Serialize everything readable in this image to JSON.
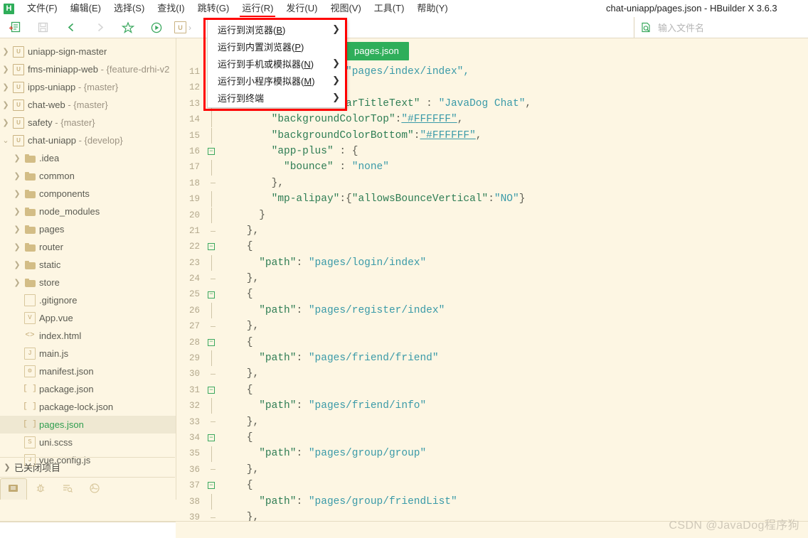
{
  "window": {
    "title": "chat-uniapp/pages.json - HBuilder X 3.6.3",
    "logo_text": "H"
  },
  "menubar": {
    "items": [
      {
        "label": "文件(F)",
        "highlighted": false
      },
      {
        "label": "编辑(E)",
        "highlighted": false
      },
      {
        "label": "选择(S)",
        "highlighted": false
      },
      {
        "label": "查找(I)",
        "highlighted": false
      },
      {
        "label": "跳转(G)",
        "highlighted": false
      },
      {
        "label": "运行(R)",
        "highlighted": true
      },
      {
        "label": "发行(U)",
        "highlighted": false
      },
      {
        "label": "视图(V)",
        "highlighted": false
      },
      {
        "label": "工具(T)",
        "highlighted": false
      },
      {
        "label": "帮助(Y)",
        "highlighted": false
      }
    ]
  },
  "toolbar": {
    "icons": [
      "new-file-icon",
      "save-icon",
      "back-arrow-icon",
      "forward-arrow-icon",
      "star-icon",
      "run-play-icon",
      "uniapp-chip-icon"
    ],
    "uni_chip_label": "U",
    "caret": "›"
  },
  "search": {
    "icon": "file-search-icon",
    "placeholder": "输入文件名",
    "value": ""
  },
  "dropdown": {
    "name": "run-menu",
    "items": [
      {
        "label": "运行到浏览器(B)",
        "mnemonic": "B",
        "submenu": true
      },
      {
        "label": "运行到内置浏览器(P)",
        "mnemonic": "P",
        "submenu": false
      },
      {
        "label": "运行到手机或模拟器(N)",
        "mnemonic": "N",
        "submenu": true
      },
      {
        "label": "运行到小程序模拟器(M)",
        "mnemonic": "M",
        "submenu": true
      },
      {
        "label": "运行到终端",
        "mnemonic": "",
        "submenu": true
      }
    ],
    "arrow_glyph": "❯",
    "highlight_color": "#ff0000"
  },
  "sidebar": {
    "projects": [
      {
        "name": "uniapp-sign-master",
        "branch": "",
        "expanded": false,
        "icon": "uniapp-project-icon"
      },
      {
        "name": "fms-miniapp-web",
        "branch": " - {feature-drhi-v2",
        "expanded": false,
        "icon": "uniapp-project-icon"
      },
      {
        "name": "ipps-uniapp",
        "branch": " - {master}",
        "expanded": false,
        "icon": "uniapp-project-icon"
      },
      {
        "name": "chat-web",
        "branch": " - {master}",
        "expanded": false,
        "icon": "uniapp-project-icon"
      },
      {
        "name": "safety",
        "branch": " - {master}",
        "expanded": false,
        "icon": "uniapp-project-icon"
      },
      {
        "name": "chat-uniapp",
        "branch": " - {develop}",
        "expanded": true,
        "icon": "uniapp-project-icon"
      }
    ],
    "children": [
      {
        "name": ".idea",
        "type": "folder",
        "icon": "folder-icon",
        "selected": false
      },
      {
        "name": "common",
        "type": "folder",
        "icon": "folder-icon",
        "selected": false
      },
      {
        "name": "components",
        "type": "folder",
        "icon": "folder-icon",
        "selected": false
      },
      {
        "name": "node_modules",
        "type": "folder",
        "icon": "folder-icon",
        "selected": false
      },
      {
        "name": "pages",
        "type": "folder",
        "icon": "folder-icon",
        "selected": false
      },
      {
        "name": "router",
        "type": "folder",
        "icon": "folder-icon",
        "selected": false
      },
      {
        "name": "static",
        "type": "folder",
        "icon": "folder-icon",
        "selected": false
      },
      {
        "name": "store",
        "type": "folder",
        "icon": "folder-icon",
        "selected": false
      },
      {
        "name": ".gitignore",
        "type": "file",
        "icon": "blank-file-icon",
        "glyph": "",
        "selected": false
      },
      {
        "name": "App.vue",
        "type": "file",
        "icon": "vue-file-icon",
        "glyph": "V",
        "selected": false
      },
      {
        "name": "index.html",
        "type": "file",
        "icon": "html-file-icon",
        "glyph": "<>",
        "selected": false
      },
      {
        "name": "main.js",
        "type": "file",
        "icon": "js-file-icon",
        "glyph": "J",
        "selected": false
      },
      {
        "name": "manifest.json",
        "type": "file",
        "icon": "manifest-file-icon",
        "glyph": "⚙",
        "selected": false
      },
      {
        "name": "package.json",
        "type": "file",
        "icon": "json-file-icon",
        "glyph": "[ ]",
        "selected": false
      },
      {
        "name": "package-lock.json",
        "type": "file",
        "icon": "json-file-icon",
        "glyph": "[ ]",
        "selected": false
      },
      {
        "name": "pages.json",
        "type": "file",
        "icon": "json-file-icon",
        "glyph": "[ ]",
        "selected": true
      },
      {
        "name": "uni.scss",
        "type": "file",
        "icon": "scss-file-icon",
        "glyph": "S",
        "selected": false
      },
      {
        "name": "vue.config.js",
        "type": "file",
        "icon": "js-file-icon",
        "glyph": "J",
        "selected": false
      }
    ],
    "closed_projects_label": "已关闭项目",
    "bottom_tabs": [
      {
        "name": "project-explorer-tab",
        "icon": "files-icon",
        "active": true
      },
      {
        "name": "debug-tab",
        "icon": "bug-icon",
        "active": false
      },
      {
        "name": "outline-tab",
        "icon": "outline-icon",
        "active": false
      },
      {
        "name": "cloud-tab",
        "icon": "cloud-icon",
        "active": false
      }
    ]
  },
  "editor": {
    "tab_label": "pages.json",
    "tab_color": "#2fae5a",
    "lines": [
      {
        "n": 11,
        "fold": "bar",
        "tokens": [
          {
            "t": "                    ",
            "c": "p"
          },
          {
            "t": "\"pages/index/index\",",
            "c": "s"
          }
        ]
      },
      {
        "n": 12,
        "fold": "bar",
        "tokens": [
          {
            "t": "",
            "c": "p"
          }
        ]
      },
      {
        "n": 13,
        "fold": "bar",
        "tokens": [
          {
            "t": "        ",
            "c": "p"
          },
          {
            "t": "\"navigationBarTitleText\"",
            "c": "k"
          },
          {
            "t": " : ",
            "c": "p"
          },
          {
            "t": "\"JavaDog Chat\"",
            "c": "s"
          },
          {
            "t": ",",
            "c": "p"
          }
        ]
      },
      {
        "n": 14,
        "fold": "bar",
        "tokens": [
          {
            "t": "        ",
            "c": "p"
          },
          {
            "t": "\"backgroundColorTop\"",
            "c": "k"
          },
          {
            "t": ":",
            "c": "p"
          },
          {
            "t": "\"#FFFFFF\"",
            "c": "u"
          },
          {
            "t": ",",
            "c": "p"
          }
        ]
      },
      {
        "n": 15,
        "fold": "bar",
        "tokens": [
          {
            "t": "        ",
            "c": "p"
          },
          {
            "t": "\"backgroundColorBottom\"",
            "c": "k"
          },
          {
            "t": ":",
            "c": "p"
          },
          {
            "t": "\"#FFFFFF\"",
            "c": "u"
          },
          {
            "t": ",",
            "c": "p"
          }
        ]
      },
      {
        "n": 16,
        "fold": "box",
        "tokens": [
          {
            "t": "        ",
            "c": "p"
          },
          {
            "t": "\"app-plus\"",
            "c": "k"
          },
          {
            "t": " : {",
            "c": "p"
          }
        ]
      },
      {
        "n": 17,
        "fold": "bar",
        "tokens": [
          {
            "t": "          ",
            "c": "p"
          },
          {
            "t": "\"bounce\"",
            "c": "k"
          },
          {
            "t": " : ",
            "c": "p"
          },
          {
            "t": "\"none\"",
            "c": "s"
          }
        ]
      },
      {
        "n": 18,
        "fold": "barT",
        "tokens": [
          {
            "t": "        },",
            "c": "p"
          }
        ]
      },
      {
        "n": 19,
        "fold": "bar",
        "tokens": [
          {
            "t": "        ",
            "c": "p"
          },
          {
            "t": "\"mp-alipay\"",
            "c": "k"
          },
          {
            "t": ":{",
            "c": "p"
          },
          {
            "t": "\"allowsBounceVertical\"",
            "c": "k"
          },
          {
            "t": ":",
            "c": "p"
          },
          {
            "t": "\"NO\"",
            "c": "s"
          },
          {
            "t": "}",
            "c": "p"
          }
        ]
      },
      {
        "n": 20,
        "fold": "bar",
        "tokens": [
          {
            "t": "      }",
            "c": "p"
          }
        ]
      },
      {
        "n": 21,
        "fold": "barT",
        "tokens": [
          {
            "t": "    },",
            "c": "p"
          }
        ]
      },
      {
        "n": 22,
        "fold": "box",
        "tokens": [
          {
            "t": "    {",
            "c": "p"
          }
        ]
      },
      {
        "n": 23,
        "fold": "bar",
        "tokens": [
          {
            "t": "      ",
            "c": "p"
          },
          {
            "t": "\"path\"",
            "c": "k"
          },
          {
            "t": ": ",
            "c": "p"
          },
          {
            "t": "\"pages/login/index\"",
            "c": "s"
          }
        ]
      },
      {
        "n": 24,
        "fold": "barT",
        "tokens": [
          {
            "t": "    },",
            "c": "p"
          }
        ]
      },
      {
        "n": 25,
        "fold": "box",
        "tokens": [
          {
            "t": "    {",
            "c": "p"
          }
        ]
      },
      {
        "n": 26,
        "fold": "bar",
        "tokens": [
          {
            "t": "      ",
            "c": "p"
          },
          {
            "t": "\"path\"",
            "c": "k"
          },
          {
            "t": ": ",
            "c": "p"
          },
          {
            "t": "\"pages/register/index\"",
            "c": "s"
          }
        ]
      },
      {
        "n": 27,
        "fold": "barT",
        "tokens": [
          {
            "t": "    },",
            "c": "p"
          }
        ]
      },
      {
        "n": 28,
        "fold": "box",
        "tokens": [
          {
            "t": "    {",
            "c": "p"
          }
        ]
      },
      {
        "n": 29,
        "fold": "bar",
        "tokens": [
          {
            "t": "      ",
            "c": "p"
          },
          {
            "t": "\"path\"",
            "c": "k"
          },
          {
            "t": ": ",
            "c": "p"
          },
          {
            "t": "\"pages/friend/friend\"",
            "c": "s"
          }
        ]
      },
      {
        "n": 30,
        "fold": "barT",
        "tokens": [
          {
            "t": "    },",
            "c": "p"
          }
        ]
      },
      {
        "n": 31,
        "fold": "box",
        "tokens": [
          {
            "t": "    {",
            "c": "p"
          }
        ]
      },
      {
        "n": 32,
        "fold": "bar",
        "tokens": [
          {
            "t": "      ",
            "c": "p"
          },
          {
            "t": "\"path\"",
            "c": "k"
          },
          {
            "t": ": ",
            "c": "p"
          },
          {
            "t": "\"pages/friend/info\"",
            "c": "s"
          }
        ]
      },
      {
        "n": 33,
        "fold": "barT",
        "tokens": [
          {
            "t": "    },",
            "c": "p"
          }
        ]
      },
      {
        "n": 34,
        "fold": "box",
        "tokens": [
          {
            "t": "    {",
            "c": "p"
          }
        ]
      },
      {
        "n": 35,
        "fold": "bar",
        "tokens": [
          {
            "t": "      ",
            "c": "p"
          },
          {
            "t": "\"path\"",
            "c": "k"
          },
          {
            "t": ": ",
            "c": "p"
          },
          {
            "t": "\"pages/group/group\"",
            "c": "s"
          }
        ]
      },
      {
        "n": 36,
        "fold": "barT",
        "tokens": [
          {
            "t": "    },",
            "c": "p"
          }
        ]
      },
      {
        "n": 37,
        "fold": "box",
        "tokens": [
          {
            "t": "    {",
            "c": "p"
          }
        ]
      },
      {
        "n": 38,
        "fold": "bar",
        "tokens": [
          {
            "t": "      ",
            "c": "p"
          },
          {
            "t": "\"path\"",
            "c": "k"
          },
          {
            "t": ": ",
            "c": "p"
          },
          {
            "t": "\"pages/group/friendList\"",
            "c": "s"
          }
        ]
      },
      {
        "n": 39,
        "fold": "barT",
        "tokens": [
          {
            "t": "    },",
            "c": "p"
          }
        ]
      }
    ]
  },
  "watermark": {
    "text": "CSDN @JavaDog程序狗"
  }
}
